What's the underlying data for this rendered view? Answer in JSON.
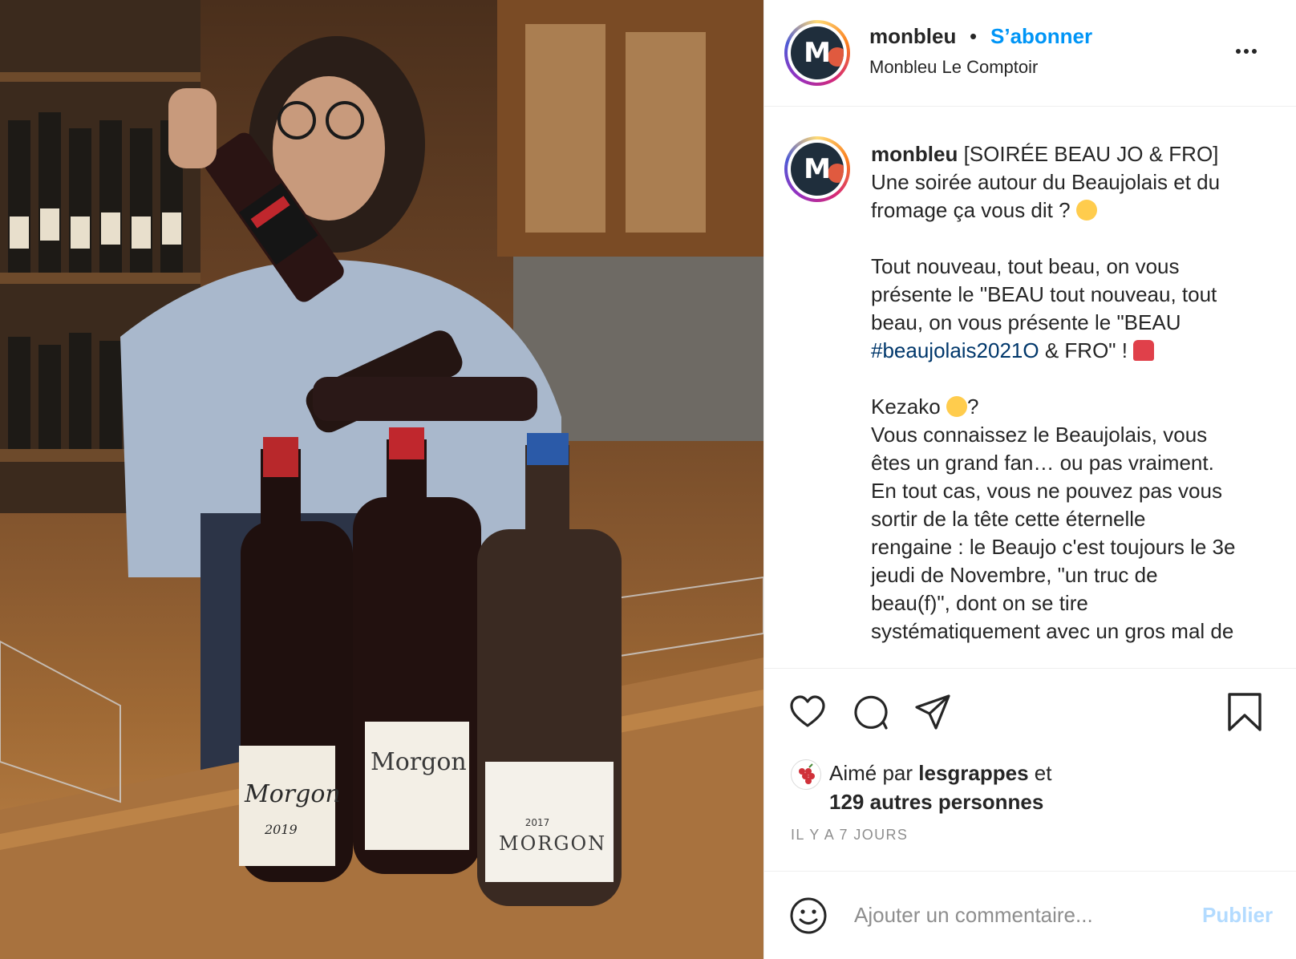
{
  "photo": {
    "alt_subject": "wine-bar-photo",
    "labels": [
      "Morgon",
      "Morgon",
      "MORGON",
      "2019",
      "2017"
    ]
  },
  "header": {
    "username": "monbleu",
    "separator": "•",
    "follow_label": "S’abonner",
    "location": "Monbleu Le Comptoir"
  },
  "caption": {
    "username": "monbleu",
    "line1": " [SOIRÉE BEAU JO & FRO]\nUne soirée autour du Beaujolais et du\nfromage ça vous dit ? ",
    "line2": "\n\nTout nouveau, tout beau, on vous\nprésente le \"BEAU tout nouveau, tout\nbeau, on vous présente le \"BEAU\n",
    "hashtag": "#beaujolais2021O",
    "line3": " & FRO\" ! ",
    "line4": "\n\nKezako ",
    "line5": "?\nVous connaissez le Beaujolais, vous\nêtes un grand fan… ou pas vraiment.\nEn tout cas, vous ne pouvez pas vous\nsortir de la tête cette éternelle\nrengaine : le Beaujo c'est toujours le 3e\njeudi de Novembre, \"un truc de\nbeau(f)\", dont on se tire\nsystématiquement avec un gros mal de",
    "emoji_names": [
      "partying-face",
      "police-light",
      "face-with-monocle"
    ]
  },
  "actions": {
    "icons": [
      "heart-icon",
      "comment-icon",
      "share-icon",
      "bookmark-icon"
    ]
  },
  "likes": {
    "prefix": "Aimé par ",
    "liker": "lesgrappes",
    "suffix": " et",
    "others": "129 autres personnes"
  },
  "timestamp": "IL Y A 7 JOURS",
  "comment": {
    "placeholder": "Ajouter un commentaire...",
    "publish_label": "Publier"
  },
  "colors": {
    "link_blue": "#0095f6",
    "hashtag_blue": "#00376b",
    "publish_disabled": "#b3dbff"
  }
}
